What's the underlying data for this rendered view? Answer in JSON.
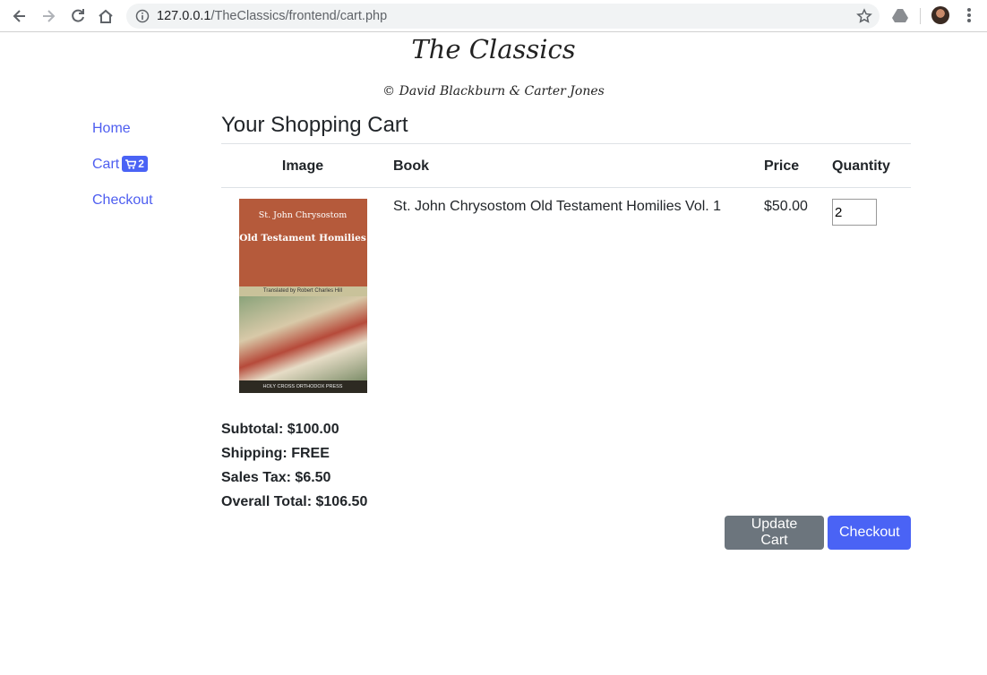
{
  "browser": {
    "url_host": "127.0.0.1",
    "url_path": "/TheClassics/frontend/cart.php"
  },
  "site": {
    "title": "The Classics",
    "credit": "© David Blackburn & Carter Jones"
  },
  "sidebar": {
    "items": [
      {
        "label": "Home"
      },
      {
        "label": "Cart",
        "badge": "2"
      },
      {
        "label": "Checkout"
      }
    ]
  },
  "cart": {
    "heading": "Your Shopping Cart",
    "columns": {
      "image": "Image",
      "book": "Book",
      "price": "Price",
      "quantity": "Quantity"
    },
    "items": [
      {
        "book": "St. John Chrysostom Old Testament Homilies Vol. 1",
        "price": "$50.00",
        "quantity": "2",
        "cover": {
          "author": "St. John Chrysostom",
          "title": "Old Testament Homilies",
          "translator": "Translated by Robert Charles Hill",
          "publisher": "HOLY CROSS ORTHODOX PRESS"
        }
      }
    ],
    "totals": {
      "subtotal": "Subtotal: $100.00",
      "shipping": "Shipping: FREE",
      "tax": "Sales Tax: $6.50",
      "overall": "Overall Total: $106.50"
    },
    "buttons": {
      "update": "Update Cart",
      "checkout": "Checkout"
    }
  },
  "colors": {
    "link": "#4e5ef0",
    "primary": "#4a63f5",
    "secondary": "#6c757d"
  }
}
